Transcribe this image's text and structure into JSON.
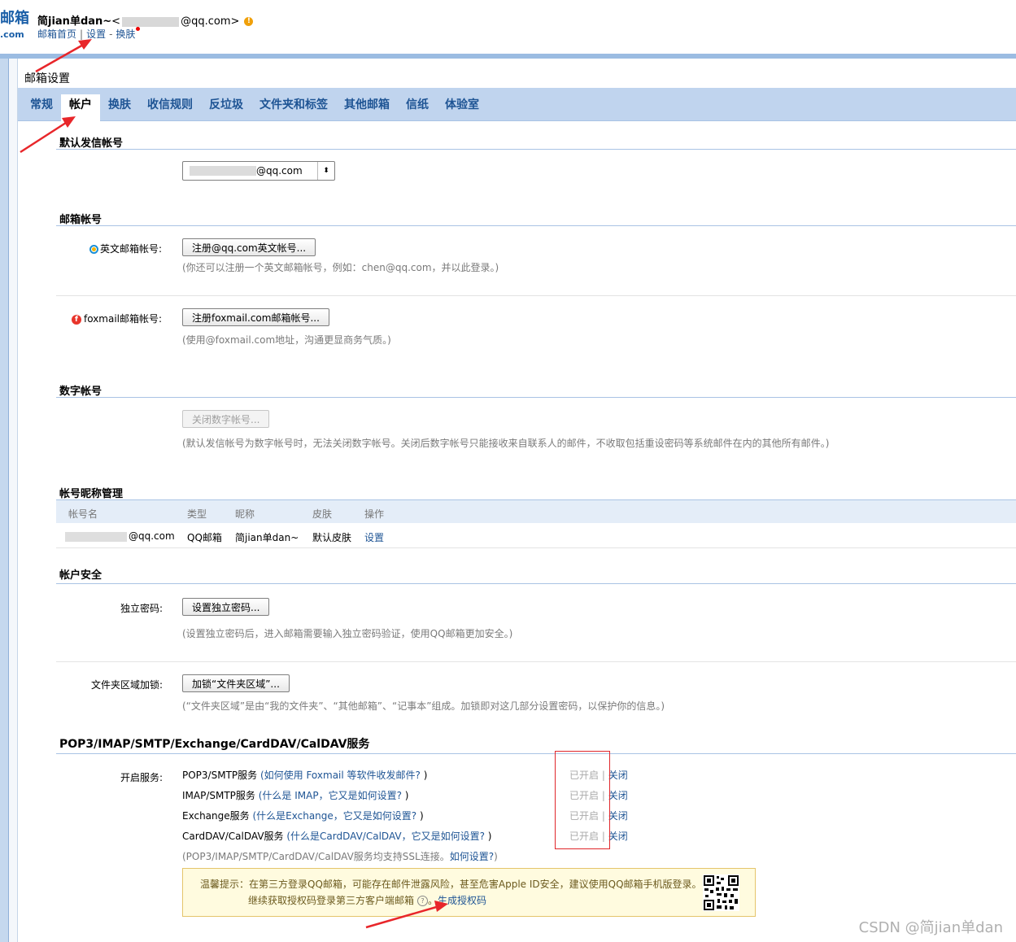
{
  "header": {
    "logo_main": "邮箱",
    "logo_sub": ".com",
    "user_name": "简jian单dan~",
    "user_email_open": "<",
    "user_email_suffix": "@qq.com>",
    "warn_icon": "!",
    "links": {
      "home": "邮箱首页",
      "sep1": "|",
      "settings": "设置",
      "sep2": "-",
      "skin": "换肤"
    }
  },
  "page_title": "邮箱设置",
  "tabs": [
    "常规",
    "帐户",
    "换肤",
    "收信规则",
    "反垃圾",
    "文件夹和标签",
    "其他邮箱",
    "信纸",
    "体验室"
  ],
  "default_account": {
    "title": "默认发信帐号",
    "selected_suffix": "@qq.com",
    "arrow": "⬍"
  },
  "mail_accounts": {
    "title": "邮箱帐号",
    "english": {
      "label": "英文邮箱帐号:",
      "button": "注册@qq.com英文帐号...",
      "hint": "(你还可以注册一个英文邮箱帐号，例如：chen@qq.com，并以此登录。)"
    },
    "foxmail": {
      "icon_letter": "f",
      "label": "foxmail邮箱帐号:",
      "button": "注册foxmail.com邮箱帐号...",
      "hint": "(使用@foxmail.com地址，沟通更显商务气质。)"
    }
  },
  "digit_account": {
    "title": "数字帐号",
    "button": "关闭数字帐号...",
    "hint": "(默认发信帐号为数字帐号时，无法关闭数字帐号。关闭后数字帐号只能接收来自联系人的邮件，不收取包括重设密码等系统邮件在内的其他所有邮件。)"
  },
  "nickname": {
    "title": "帐号昵称管理",
    "headers": [
      "帐号名",
      "类型",
      "昵称",
      "皮肤",
      "操作"
    ],
    "row": {
      "account_suffix": "@qq.com",
      "type": "QQ邮箱",
      "nick": "简jian单dan~",
      "skin": "默认皮肤",
      "action": "设置"
    }
  },
  "security": {
    "title": "帐户安全",
    "pwd": {
      "label": "独立密码:",
      "button": "设置独立密码...",
      "hint": "(设置独立密码后，进入邮箱需要输入独立密码验证，使用QQ邮箱更加安全。)"
    },
    "folder": {
      "label": "文件夹区域加锁:",
      "button": "加锁“文件夹区域”...",
      "hint": "(“文件夹区域”是由“我的文件夹”、“其他邮箱”、“记事本”组成。加锁即对这几部分设置密码，以保护你的信息。)"
    }
  },
  "services": {
    "title": "POP3/IMAP/SMTP/Exchange/CardDAV/CalDAV服务",
    "label": "开启服务:",
    "items": [
      {
        "name": "POP3/SMTP服务",
        "open": " (",
        "link": "如何使用 Foxmail 等软件收发邮件?",
        "close": " )"
      },
      {
        "name": "IMAP/SMTP服务",
        "open": " (",
        "link": "什么是 IMAP，它又是如何设置?",
        "close": " )"
      },
      {
        "name": "Exchange服务",
        "open": " (",
        "link": "什么是Exchange，它又是如何设置?",
        "close": " )"
      },
      {
        "name": "CardDAV/CalDAV服务",
        "open": " (",
        "link": "什么是CardDAV/CalDAV，它又是如何设置?",
        "close": " )"
      }
    ],
    "status_on": "已开启",
    "status_sep": "|",
    "status_off": "关闭",
    "ssl_text": "(POP3/IMAP/SMTP/CardDAV/CalDAV服务均支持SSL连接。",
    "ssl_link": "如何设置?",
    "ssl_close": ")"
  },
  "tip": {
    "line1": "温馨提示：在第三方登录QQ邮箱，可能存在邮件泄露风险，甚至危害Apple ID安全，建议使用QQ邮箱手机版登录。",
    "line2": "继续获取授权码登录第三方客户端邮箱",
    "qmark": "?",
    "dot": "。",
    "link": "生成授权码"
  },
  "watermark": "CSDN @简jian单dan"
}
